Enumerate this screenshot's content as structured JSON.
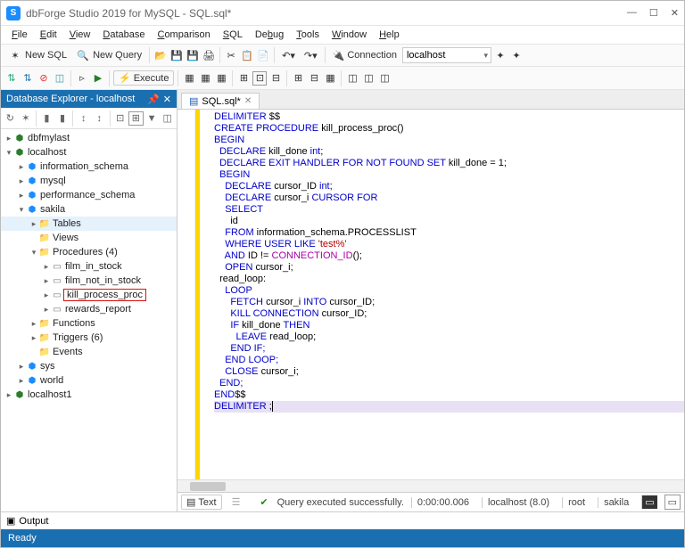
{
  "window": {
    "title": "dbForge Studio 2019 for MySQL - SQL.sql*"
  },
  "menu": [
    "File",
    "Edit",
    "View",
    "Database",
    "Comparison",
    "SQL",
    "Debug",
    "Tools",
    "Window",
    "Help"
  ],
  "toolbar1": {
    "new_sql": "New SQL",
    "new_query": "New Query",
    "conn_label": "Connection",
    "conn_value": "localhost"
  },
  "toolbar2": {
    "execute": "Execute"
  },
  "explorer": {
    "title": "Database Explorer - localhost",
    "nodes": [
      {
        "d": 0,
        "exp": "▸",
        "icon": "cyl",
        "label": "dbfmylast"
      },
      {
        "d": 0,
        "exp": "▾",
        "icon": "cyl",
        "label": "localhost"
      },
      {
        "d": 1,
        "exp": "▸",
        "icon": "db",
        "label": "information_schema"
      },
      {
        "d": 1,
        "exp": "▸",
        "icon": "db",
        "label": "mysql"
      },
      {
        "d": 1,
        "exp": "▸",
        "icon": "db",
        "label": "performance_schema"
      },
      {
        "d": 1,
        "exp": "▾",
        "icon": "db",
        "label": "sakila"
      },
      {
        "d": 2,
        "exp": "▸",
        "icon": "folder",
        "label": "Tables",
        "sel": true
      },
      {
        "d": 2,
        "exp": " ",
        "icon": "folder",
        "label": "Views"
      },
      {
        "d": 2,
        "exp": "▾",
        "icon": "folder",
        "label": "Procedures (4)"
      },
      {
        "d": 3,
        "exp": "▸",
        "icon": "proc",
        "label": "film_in_stock"
      },
      {
        "d": 3,
        "exp": "▸",
        "icon": "proc",
        "label": "film_not_in_stock"
      },
      {
        "d": 3,
        "exp": "▸",
        "icon": "proc",
        "label": "kill_process_proc",
        "hl": true
      },
      {
        "d": 3,
        "exp": "▸",
        "icon": "proc",
        "label": "rewards_report"
      },
      {
        "d": 2,
        "exp": "▸",
        "icon": "folder",
        "label": "Functions"
      },
      {
        "d": 2,
        "exp": "▸",
        "icon": "folder",
        "label": "Triggers (6)"
      },
      {
        "d": 2,
        "exp": " ",
        "icon": "folder",
        "label": "Events"
      },
      {
        "d": 1,
        "exp": "▸",
        "icon": "db",
        "label": "sys"
      },
      {
        "d": 1,
        "exp": "▸",
        "icon": "db",
        "label": "world"
      },
      {
        "d": 0,
        "exp": "▸",
        "icon": "cyl",
        "label": "localhost1"
      }
    ]
  },
  "editor": {
    "tab": "SQL.sql*",
    "foot": {
      "text_btn": "Text",
      "success": "Query executed successfully.",
      "time": "0:00:00.006",
      "conn": "localhost (8.0)",
      "user": "root",
      "db": "sakila"
    }
  },
  "code": {
    "l1a": "DELIMITER",
    "l1b": " $$",
    "l2a": "CREATE PROCEDURE ",
    "l2b": "kill_process_proc",
    "l2c": "()",
    "l3": "BEGIN",
    "l4a": "  DECLARE ",
    "l4b": "kill_done ",
    "l4c": "int",
    "l4d": ";",
    "l5a": "  DECLARE EXIT HANDLER FOR NOT FOUND SET ",
    "l5b": "kill_done = ",
    "l5c": "1",
    "l5d": ";",
    "l6": "  BEGIN",
    "l7a": "    DECLARE ",
    "l7b": "cursor_ID ",
    "l7c": "int",
    "l7d": ";",
    "l8a": "    DECLARE ",
    "l8b": "cursor_i ",
    "l8c": "CURSOR FOR",
    "l9": "    SELECT",
    "l10": "      id",
    "l11a": "    FROM ",
    "l11b": "information_schema.PROCESSLIST",
    "l12a": "    WHERE USER LIKE ",
    "l12b": "'test%'",
    "l13a": "    AND ",
    "l13b": "ID != ",
    "l13c": "CONNECTION_ID",
    "l13d": "();",
    "l14a": "    OPEN ",
    "l14b": "cursor_i;",
    "l15": "  read_loop:",
    "l16": "    LOOP",
    "l17a": "      FETCH ",
    "l17b": "cursor_i ",
    "l17c": "INTO ",
    "l17d": "cursor_ID;",
    "l18a": "      KILL CONNECTION ",
    "l18b": "cursor_ID;",
    "l19a": "      IF ",
    "l19b": "kill_done ",
    "l19c": "THEN",
    "l20a": "        LEAVE ",
    "l20b": "read_loop;",
    "l21": "      END IF;",
    "l22": "    END LOOP;",
    "l23a": "    CLOSE ",
    "l23b": "cursor_i;",
    "l24": "  END;",
    "l25a": "END",
    "l25b": "$$",
    "l26a": "DELIMITER ",
    "l26b": ";"
  },
  "output": {
    "label": "Output"
  },
  "status": {
    "text": "Ready"
  }
}
